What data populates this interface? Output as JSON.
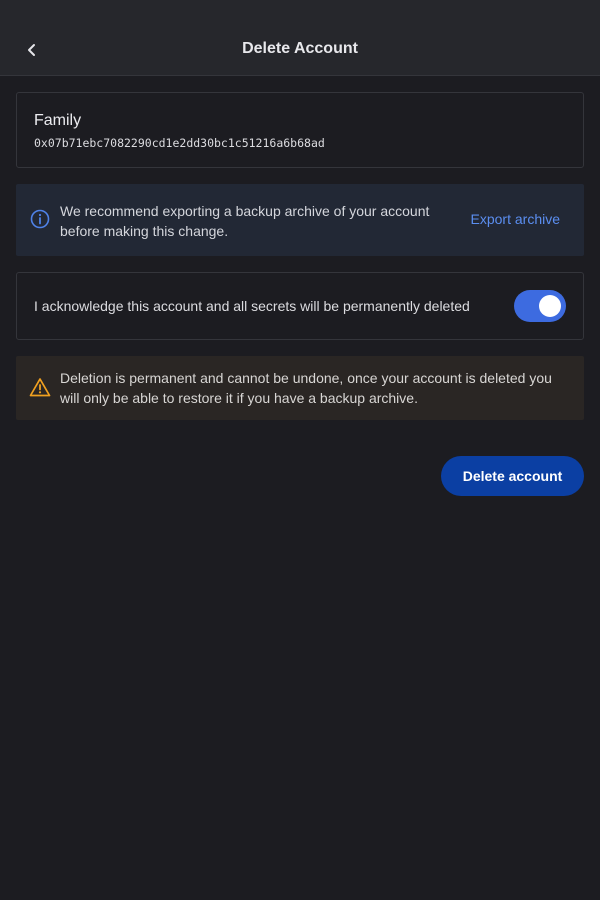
{
  "appbar": {
    "title": "Delete Account",
    "back_icon": "chevron-left-icon"
  },
  "account": {
    "name": "Family",
    "address": "0x07b71ebc7082290cd1e2dd30bc1c51216a6b68ad"
  },
  "info": {
    "icon": "info-icon",
    "text_line1": "We recommend exporting a backup archive of your account",
    "text_line2": "before making this change.",
    "export_label": "Export archive"
  },
  "acknowledge": {
    "label": "I acknowledge this account and all secrets will be permanently deleted",
    "checked": true
  },
  "warning": {
    "icon": "warning-icon",
    "text_line1": "Deletion is permanent and cannot be undone, once your account is deleted you",
    "text_line2": "will only be able to restore it if you have a backup archive."
  },
  "actions": {
    "delete_label": "Delete account"
  },
  "colors": {
    "background": "#1c1c21",
    "appbar": "#26272c",
    "accent": "#3d6be0",
    "link": "#5b8ef0",
    "primary_button": "#0b3fa3",
    "warning": "#f0a020"
  }
}
